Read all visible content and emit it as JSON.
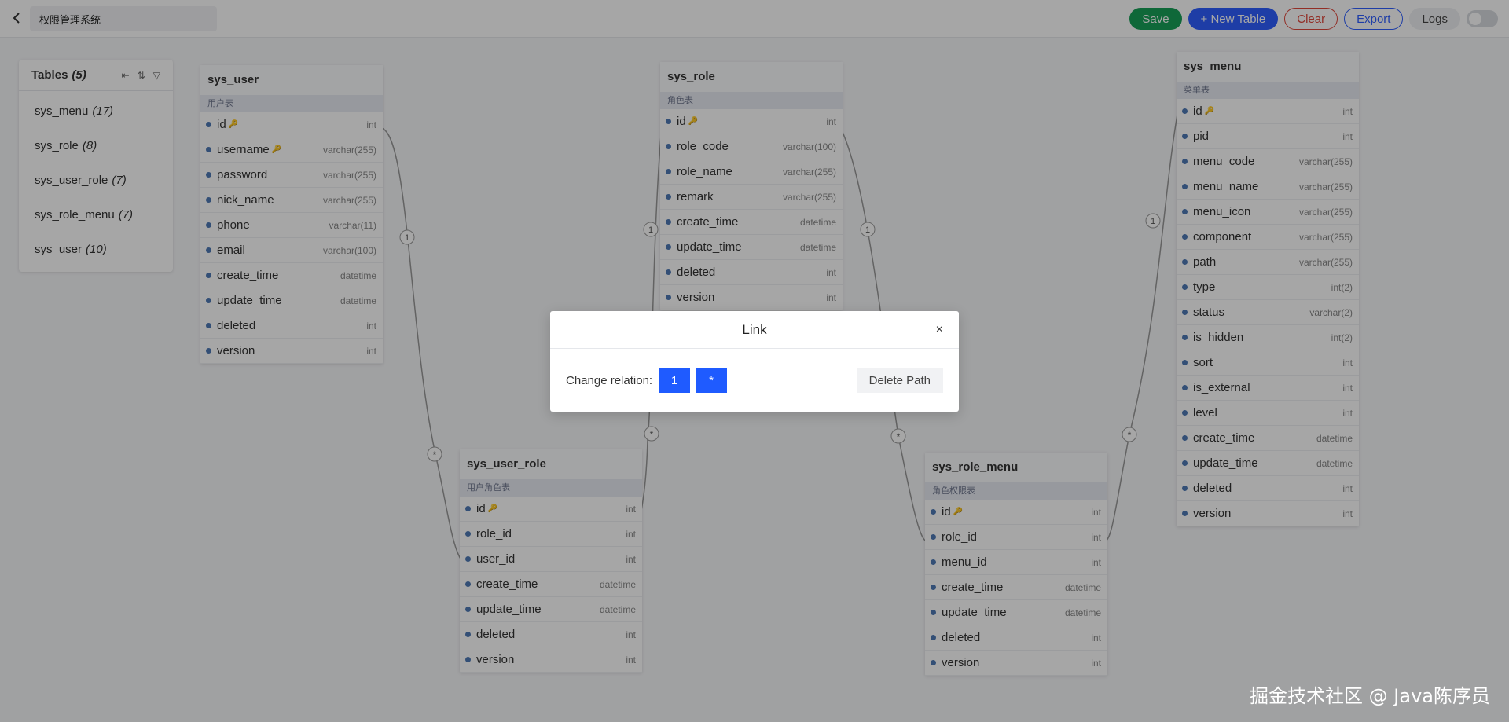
{
  "header": {
    "project_name": "权限管理系统",
    "buttons": {
      "save": "Save",
      "new_table": "+ New Table",
      "clear": "Clear",
      "export": "Export",
      "logs": "Logs"
    },
    "dark_mode_on": false
  },
  "tables_panel": {
    "title": "Tables",
    "count": "(5)",
    "items": [
      {
        "name": "sys_menu",
        "count": "(17)"
      },
      {
        "name": "sys_role",
        "count": "(8)"
      },
      {
        "name": "sys_user_role",
        "count": "(7)"
      },
      {
        "name": "sys_role_menu",
        "count": "(7)"
      },
      {
        "name": "sys_user",
        "count": "(10)"
      }
    ]
  },
  "tables": [
    {
      "name": "sys_user",
      "comment": "用户表",
      "fields": [
        {
          "name": "id",
          "type": "int",
          "key": true
        },
        {
          "name": "username",
          "type": "varchar(255)",
          "key": true
        },
        {
          "name": "password",
          "type": "varchar(255)"
        },
        {
          "name": "nick_name",
          "type": "varchar(255)"
        },
        {
          "name": "phone",
          "type": "varchar(11)"
        },
        {
          "name": "email",
          "type": "varchar(100)"
        },
        {
          "name": "create_time",
          "type": "datetime"
        },
        {
          "name": "update_time",
          "type": "datetime"
        },
        {
          "name": "deleted",
          "type": "int"
        },
        {
          "name": "version",
          "type": "int"
        }
      ]
    },
    {
      "name": "sys_role",
      "comment": "角色表",
      "fields": [
        {
          "name": "id",
          "type": "int",
          "key": true
        },
        {
          "name": "role_code",
          "type": "varchar(100)"
        },
        {
          "name": "role_name",
          "type": "varchar(255)"
        },
        {
          "name": "remark",
          "type": "varchar(255)"
        },
        {
          "name": "create_time",
          "type": "datetime"
        },
        {
          "name": "update_time",
          "type": "datetime"
        },
        {
          "name": "deleted",
          "type": "int"
        },
        {
          "name": "version",
          "type": "int"
        }
      ]
    },
    {
      "name": "sys_menu",
      "comment": "菜单表",
      "fields": [
        {
          "name": "id",
          "type": "int",
          "key": true
        },
        {
          "name": "pid",
          "type": "int"
        },
        {
          "name": "menu_code",
          "type": "varchar(255)"
        },
        {
          "name": "menu_name",
          "type": "varchar(255)"
        },
        {
          "name": "menu_icon",
          "type": "varchar(255)"
        },
        {
          "name": "component",
          "type": "varchar(255)"
        },
        {
          "name": "path",
          "type": "varchar(255)"
        },
        {
          "name": "type",
          "type": "int(2)"
        },
        {
          "name": "status",
          "type": "varchar(2)"
        },
        {
          "name": "is_hidden",
          "type": "int(2)"
        },
        {
          "name": "sort",
          "type": "int"
        },
        {
          "name": "is_external",
          "type": "int"
        },
        {
          "name": "level",
          "type": "int"
        },
        {
          "name": "create_time",
          "type": "datetime"
        },
        {
          "name": "update_time",
          "type": "datetime"
        },
        {
          "name": "deleted",
          "type": "int"
        },
        {
          "name": "version",
          "type": "int"
        }
      ]
    },
    {
      "name": "sys_user_role",
      "comment": "用户角色表",
      "fields": [
        {
          "name": "id",
          "type": "int",
          "key": true
        },
        {
          "name": "role_id",
          "type": "int"
        },
        {
          "name": "user_id",
          "type": "int"
        },
        {
          "name": "create_time",
          "type": "datetime"
        },
        {
          "name": "update_time",
          "type": "datetime"
        },
        {
          "name": "deleted",
          "type": "int"
        },
        {
          "name": "version",
          "type": "int"
        }
      ]
    },
    {
      "name": "sys_role_menu",
      "comment": "角色权限表",
      "fields": [
        {
          "name": "id",
          "type": "int",
          "key": true
        },
        {
          "name": "role_id",
          "type": "int"
        },
        {
          "name": "menu_id",
          "type": "int"
        },
        {
          "name": "create_time",
          "type": "datetime"
        },
        {
          "name": "update_time",
          "type": "datetime"
        },
        {
          "name": "deleted",
          "type": "int"
        },
        {
          "name": "version",
          "type": "int"
        }
      ]
    }
  ],
  "relations": {
    "one_label": "1",
    "many_label": "*"
  },
  "modal": {
    "title": "Link",
    "close": "×",
    "change_relation_label": "Change relation:",
    "one_button": "1",
    "many_button": "*",
    "delete_path": "Delete Path"
  },
  "watermark": "掘金技术社区 @ Java陈序员"
}
